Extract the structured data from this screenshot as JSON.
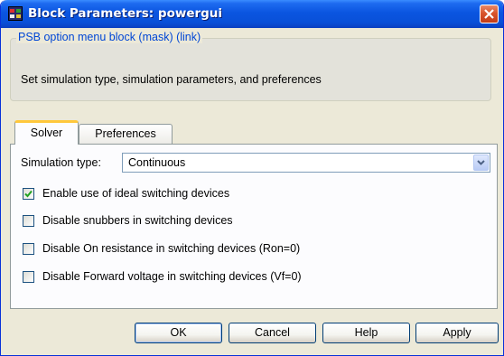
{
  "window": {
    "title": "Block Parameters: powergui",
    "app_icon": "simulink-block-icon",
    "close_icon": "close-icon"
  },
  "description_group": {
    "legend": "PSB option menu block (mask) (link)",
    "text": "Set simulation type, simulation parameters, and preferences"
  },
  "tabs": [
    {
      "label": "Solver",
      "selected": true
    },
    {
      "label": "Preferences",
      "selected": false
    }
  ],
  "solver": {
    "simulation_type_label": "Simulation type:",
    "simulation_type_value": "Continuous",
    "checkboxes": [
      {
        "label": "Enable use of ideal switching devices",
        "checked": true
      },
      {
        "label": "Disable snubbers in switching devices",
        "checked": false
      },
      {
        "label": "Disable On resistance in switching devices (Ron=0)",
        "checked": false
      },
      {
        "label": "Disable Forward voltage in switching devices (Vf=0)",
        "checked": false
      }
    ]
  },
  "buttons": {
    "ok": "OK",
    "cancel": "Cancel",
    "help": "Help",
    "apply": "Apply"
  },
  "colors": {
    "titlebar": "#0a55e0",
    "legend_text": "#0046d5",
    "checkmark": "#21a121",
    "selected_tab_accent": "#ffc83c"
  }
}
